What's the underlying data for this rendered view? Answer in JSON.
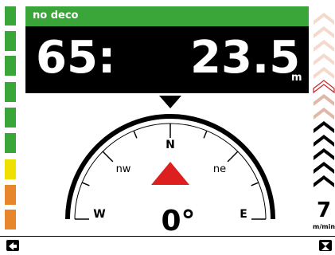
{
  "header": {
    "deco_status": "no deco"
  },
  "depth_panel": {
    "dive_time": "65:",
    "depth": "23.5",
    "depth_unit": "m"
  },
  "compass": {
    "heading": "0°",
    "labels": {
      "north": "N",
      "northwest": "nw",
      "northeast": "ne",
      "west": "W",
      "east": "E"
    }
  },
  "ascent": {
    "rate_value": "7",
    "rate_unit": "m/min"
  },
  "tissue_bar": {
    "segments": [
      "green",
      "green",
      "green",
      "green",
      "green",
      "green",
      "yellow",
      "orange",
      "orange"
    ]
  },
  "icons": {
    "left_button": "arrow-left-icon",
    "right_button": "hourglass-icon"
  },
  "colors": {
    "header_green": "#3aa63a",
    "panel_black": "#000000",
    "tissue_green": "#3aa63a",
    "tissue_yellow": "#f0e000",
    "tissue_orange": "#e8862c",
    "pointer_red": "#dd1f1f",
    "chevron_faint": "#f5d9cc",
    "chevron_mid": "#e0b8a8",
    "chevron_red": "#cc2222",
    "chevron_black": "#000000"
  }
}
